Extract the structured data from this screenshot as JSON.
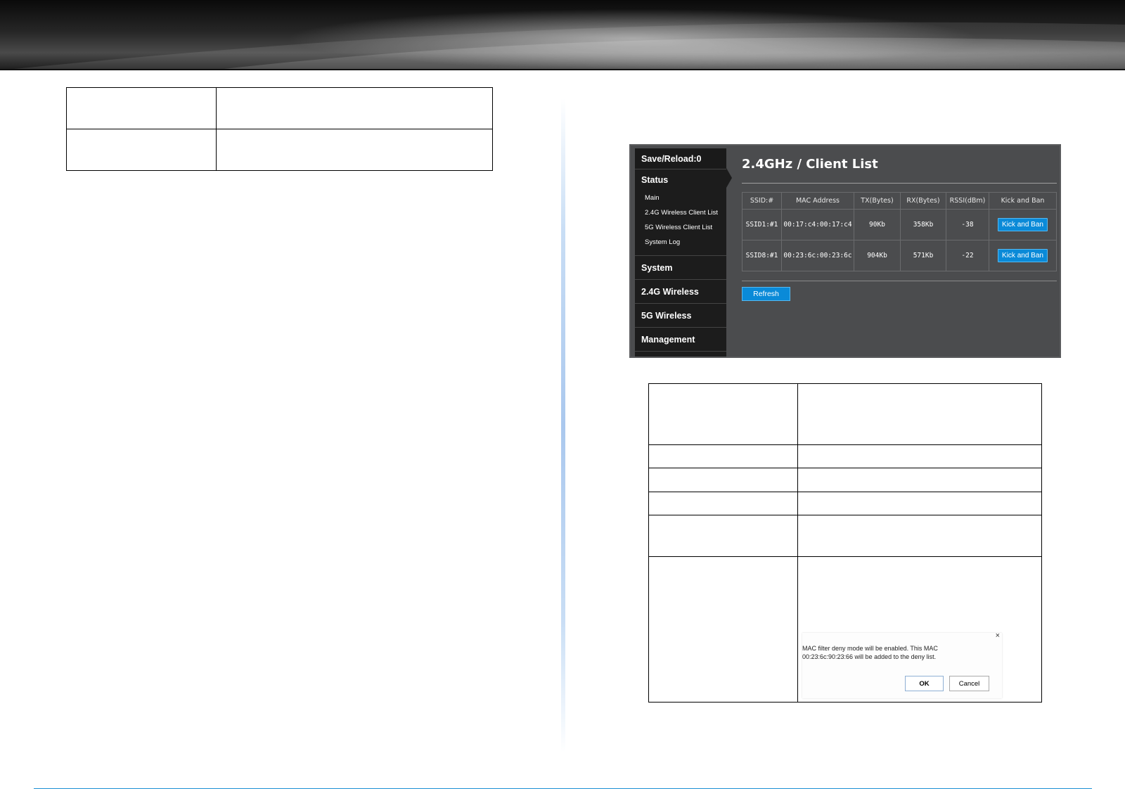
{
  "router_ui": {
    "sidebar": {
      "save_reload": "Save/Reload:0",
      "status": "Status",
      "status_items": [
        "Main",
        "2.4G Wireless Client List",
        "5G Wireless Client List",
        "System Log"
      ],
      "sections": [
        "System",
        "2.4G Wireless",
        "5G Wireless",
        "Management"
      ]
    },
    "title": "2.4GHz / Client List",
    "table": {
      "headers": [
        "SSID:#",
        "MAC Address",
        "TX(Bytes)",
        "RX(Bytes)",
        "RSSI(dBm)",
        "Kick and Ban"
      ],
      "rows": [
        {
          "ssid": "SSID1:#1",
          "mac": "00:17:c4:00:17:c4",
          "tx": "90Kb",
          "rx": "358Kb",
          "rssi": "-38",
          "action": "Kick and Ban"
        },
        {
          "ssid": "SSID8:#1",
          "mac": "00:23:6c:00:23:6c",
          "tx": "904Kb",
          "rx": "571Kb",
          "rssi": "-22",
          "action": "Kick and Ban"
        }
      ]
    },
    "refresh_label": "Refresh"
  },
  "dialog": {
    "message": "MAC filter deny mode will be enabled. This MAC 00:23:6c:90:23:66 will be added to the deny list.",
    "close": "×",
    "ok_label": "OK",
    "cancel_label": "Cancel"
  },
  "colors": {
    "accent_blue": "#0a8ad8",
    "panel_bg": "#4b4c4e",
    "sidebar_bg": "#1c1c1c",
    "rule_blue": "#1b8fd4"
  }
}
